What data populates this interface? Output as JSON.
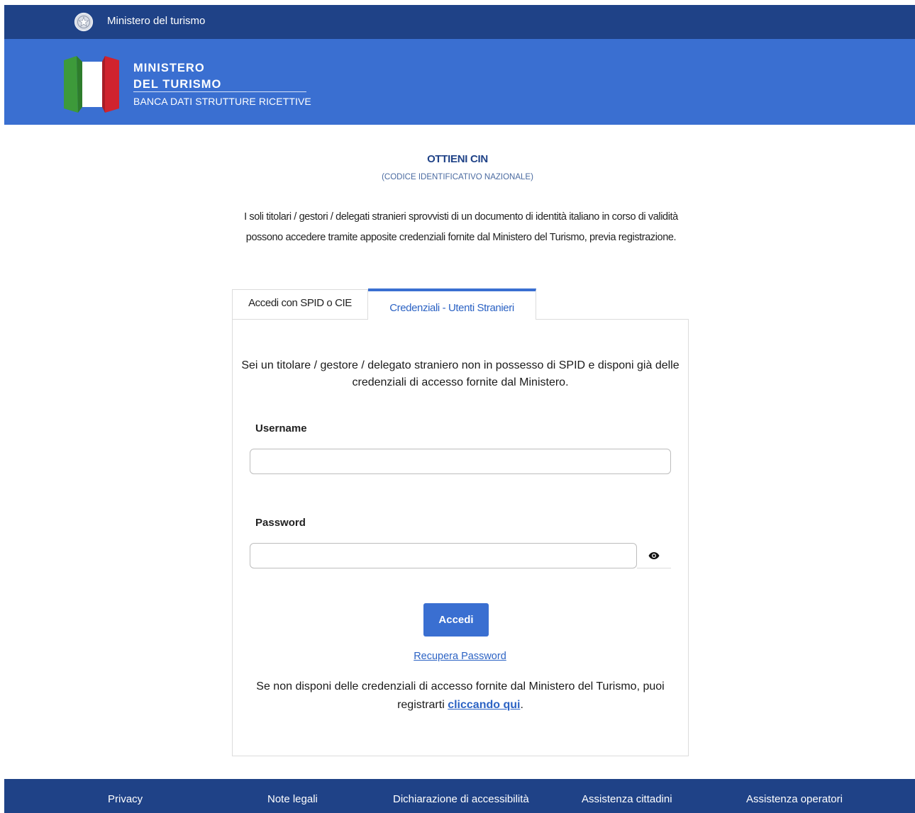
{
  "topbar": {
    "label": "Ministero del turismo",
    "emblem_icon": "italian-republic-emblem-icon"
  },
  "header": {
    "name_line1": "MINISTERO",
    "name_line2": "DEL TURISMO",
    "subtitle": "BANCA DATI STRUTTURE RICETTIVE",
    "flag_icon": "italian-flag-icon",
    "colors": {
      "bar": "#1f4287",
      "header": "#3a6fd1",
      "flag_green": "#3d9a3a",
      "flag_red": "#d0232e"
    }
  },
  "page": {
    "title": "OTTIENI CIN",
    "subtitle": "(CODICE IDENTIFICATIVO NAZIONALE)",
    "intro": "I soli titolari / gestori / delegati stranieri sprovvisti di un documento di identità italiano in corso di validità possono accedere tramite apposite credenziali fornite dal Ministero del Turismo, previa registrazione."
  },
  "tabs": [
    {
      "label": "Accedi con SPID o CIE",
      "active": false
    },
    {
      "label": "Credenziali - Utenti Stranieri",
      "active": true
    }
  ],
  "form": {
    "intro": "Sei un titolare / gestore / delegato straniero non in possesso di SPID e disponi già delle credenziali di accesso fornite dal Ministero.",
    "username_label": "Username",
    "username_value": "",
    "password_label": "Password",
    "password_value": "",
    "show_password_icon": "eye-icon",
    "submit_label": "Accedi",
    "recover_link": "Recupera Password",
    "register_text_before": "Se non disponi delle credenziali di accesso fornite dal Ministero del Turismo, puoi registrarti ",
    "register_link": "cliccando qui",
    "register_text_after": "."
  },
  "footer": {
    "links": [
      "Privacy",
      "Note legali",
      "Dichiarazione di accessibilità",
      "Assistenza cittadini",
      "Assistenza operatori"
    ]
  }
}
